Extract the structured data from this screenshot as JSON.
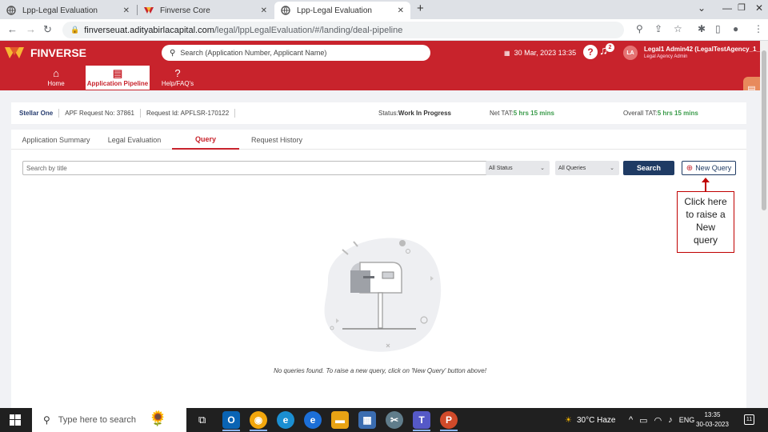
{
  "browser": {
    "tabs": [
      {
        "label": "Lpp-Legal Evaluation",
        "active": false
      },
      {
        "label": "Finverse Core",
        "active": false
      },
      {
        "label": "Lpp-Legal Evaluation",
        "active": true
      }
    ],
    "new_tab": "+",
    "url_host": "finverseuat.adityabirlacapital.com",
    "url_path": "/legal/lppLegalEvaluation/#/landing/deal-pipeline"
  },
  "header": {
    "brand": "FINVERSE",
    "search_placeholder": "Search (Application Number, Applicant Name)",
    "datetime": "30 Mar, 2023 13:35",
    "help": "?",
    "notification_count": "2",
    "avatar_initials": "LA",
    "user_name": "Legal1 Admin42 (LegalTestAgency_1_4",
    "user_role": "Legal Agency Admin",
    "nav": [
      {
        "label": "Home",
        "icon": "home-icon",
        "active": false
      },
      {
        "label": "Application Pipeline",
        "icon": "document-icon",
        "active": true
      },
      {
        "label": "Help/FAQ's",
        "icon": "question-icon",
        "active": false
      }
    ]
  },
  "info": {
    "entity": "Stellar One",
    "apf_request": "APF Request No: 37861",
    "request_id": "Request Id: APFLSR-170122",
    "status_label": "Status: ",
    "status_value": "Work In Progress",
    "net_tat_label": "Net TAT: ",
    "net_tat_value": "5 hrs 15 mins",
    "overall_tat_label": "Overall TAT: ",
    "overall_tat_value": "5 hrs 15 mins"
  },
  "page_tabs": [
    {
      "label": "Application Summary",
      "active": false
    },
    {
      "label": "Legal Evaluation",
      "active": false
    },
    {
      "label": "Query",
      "active": true
    },
    {
      "label": "Request History",
      "active": false
    }
  ],
  "filters": {
    "search_placeholder": "Search by title",
    "status_select": "All Status",
    "queries_select": "All Queries",
    "search_button": "Search",
    "new_query_button": "New Query"
  },
  "callout": {
    "lines": [
      "Click here",
      "to raise a",
      "New",
      "query"
    ],
    "color": "#c00000"
  },
  "empty_state": {
    "message": "No queries found. To raise a new query, click on 'New Query' button above!"
  },
  "taskbar": {
    "search_placeholder": "Type here to search",
    "weather": "30°C  Haze",
    "language": "ENG",
    "time": "13:35",
    "date": "30-03-2023",
    "notifications": "11"
  },
  "colors": {
    "brand_red": "#c8232c",
    "navy": "#1f3b64",
    "green": "#3a9b4a"
  }
}
